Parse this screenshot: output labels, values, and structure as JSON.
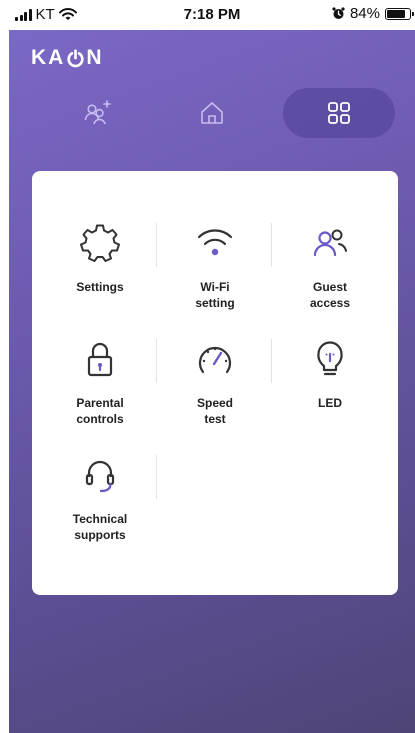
{
  "status_bar": {
    "carrier": "KT",
    "time": "7:18 PM",
    "battery_percent": "84%",
    "battery_level": 0.84
  },
  "brand": {
    "logo_prefix": "KA",
    "logo_suffix": "N",
    "logo_o_icon": "power-o-icon"
  },
  "tabs": [
    {
      "name": "add-device",
      "icon": "add-people-icon",
      "active": false
    },
    {
      "name": "home",
      "icon": "home-icon",
      "active": false
    },
    {
      "name": "menu",
      "icon": "grid-icon",
      "active": true
    }
  ],
  "menu": {
    "items": [
      {
        "label": "Settings",
        "icon": "gear-icon"
      },
      {
        "label": "Wi-Fi\nsetting",
        "icon": "wifi-icon"
      },
      {
        "label": "Guest\naccess",
        "icon": "guest-users-icon"
      },
      {
        "label": "Parental\ncontrols",
        "icon": "lock-icon"
      },
      {
        "label": "Speed\ntest",
        "icon": "speedometer-icon"
      },
      {
        "label": "LED",
        "icon": "lightbulb-icon"
      },
      {
        "label": "Technical\nsupports",
        "icon": "headset-icon"
      }
    ]
  },
  "colors": {
    "accent": "#6c58c6",
    "icon_dark": "#333333",
    "bg_top": "#7d69c8",
    "bg_bottom": "#4f4477"
  }
}
